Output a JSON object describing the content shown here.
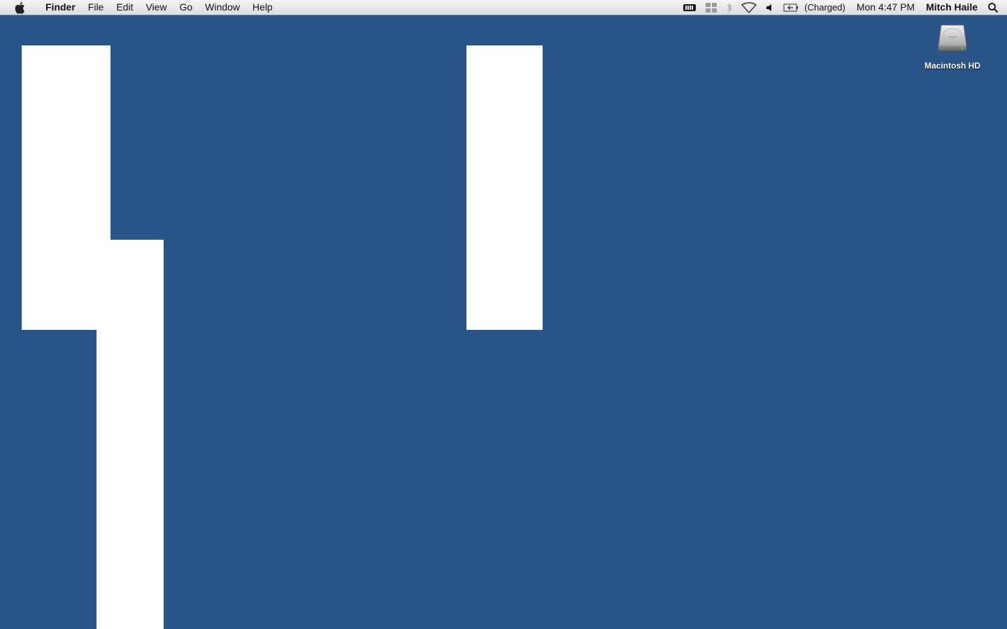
{
  "menubar": {
    "app_name": "Finder",
    "menus": [
      "File",
      "Edit",
      "View",
      "Go",
      "Window",
      "Help"
    ],
    "status": {
      "battery_text": "(Charged)",
      "clock": "Mon 4:47 PM",
      "user": "Mitch Haile"
    },
    "status_icons": [
      "keyboard-icon",
      "spaces-icon",
      "bluetooth-icon",
      "wifi-icon",
      "volume-icon",
      "battery-icon",
      "spotlight-icon"
    ]
  },
  "desktop": {
    "background_color": "#2a5588",
    "icons": [
      {
        "label": "Macintosh HD",
        "icon": "hard-drive-icon"
      }
    ]
  }
}
